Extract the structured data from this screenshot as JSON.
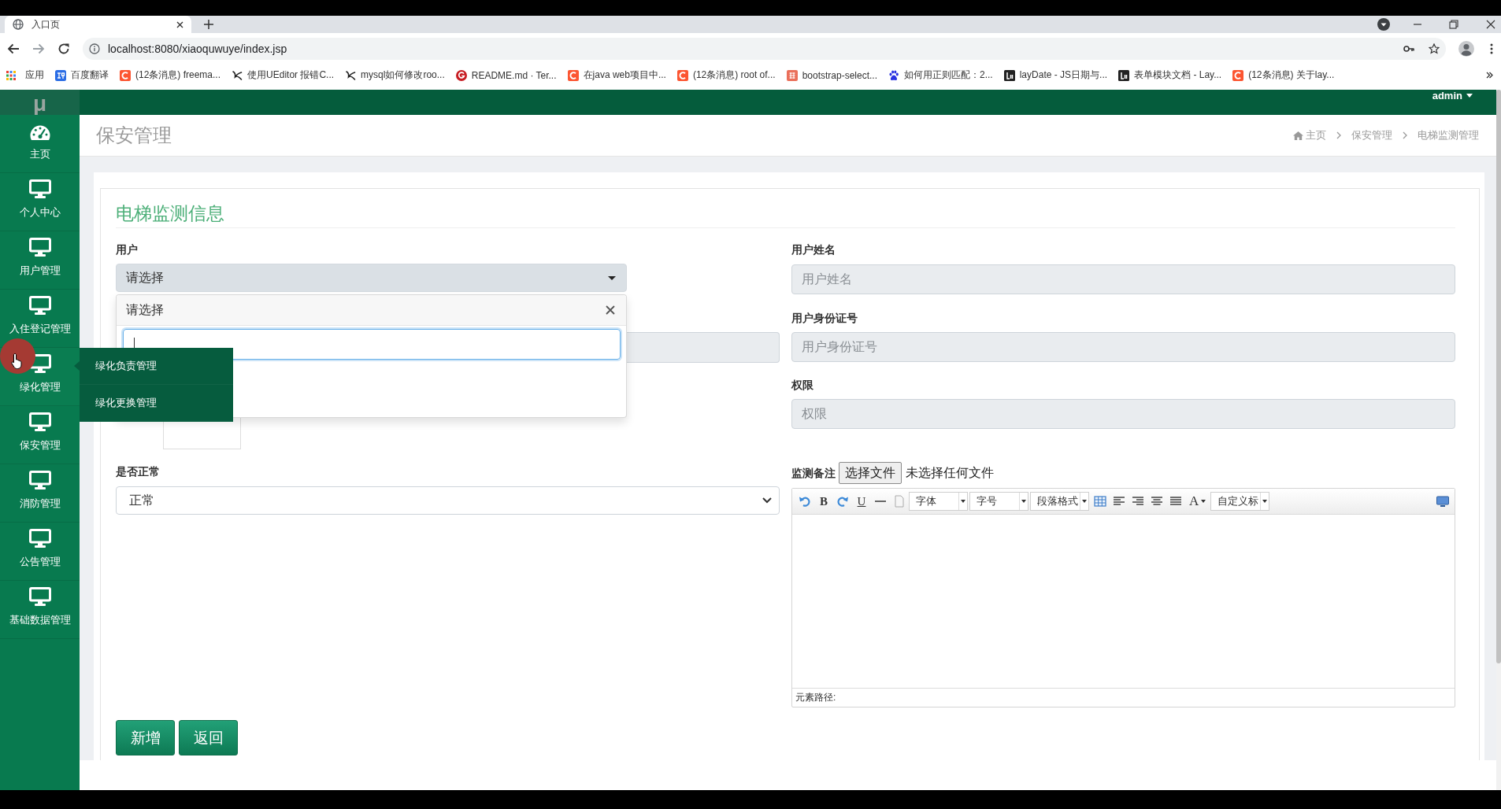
{
  "browser": {
    "tab_title": "入口页",
    "url": "localhost:8080/xiaoquwuye/index.jsp",
    "bookmarks": [
      {
        "label": "应用",
        "kind": "apps"
      },
      {
        "label": "百度翻译",
        "kind": "translate"
      },
      {
        "label": "(12条消息) freema...",
        "kind": "csdn"
      },
      {
        "label": "使用UEditor 报错C...",
        "kind": "swoosh"
      },
      {
        "label": "mysql如何修改roo...",
        "kind": "swoosh"
      },
      {
        "label": "README.md · Ter...",
        "kind": "gitee"
      },
      {
        "label": "在java web项目中...",
        "kind": "csdn"
      },
      {
        "label": "(12条消息) root of...",
        "kind": "csdn"
      },
      {
        "label": "bootstrap-select...",
        "kind": "jianshu"
      },
      {
        "label": "如何用正则匹配：2...",
        "kind": "paw"
      },
      {
        "label": "layDate - JS日期与...",
        "kind": "layui"
      },
      {
        "label": "表单模块文档 - Lay...",
        "kind": "layui"
      },
      {
        "label": "(12条消息) 关于lay...",
        "kind": "csdn"
      }
    ]
  },
  "app": {
    "logo": "μ",
    "user": "admin"
  },
  "sidebar": {
    "items": [
      {
        "label": "主页",
        "kind": "home",
        "expanded": false
      },
      {
        "label": "个人中心",
        "kind": "module",
        "expanded": false
      },
      {
        "label": "用户管理",
        "kind": "module",
        "expanded": false
      },
      {
        "label": "入住登记管理",
        "kind": "module",
        "expanded": false
      },
      {
        "label": "绿化管理",
        "kind": "module",
        "expanded": true,
        "submenu": [
          "绿化负责管理",
          "绿化更换管理"
        ]
      },
      {
        "label": "保安管理",
        "kind": "module",
        "expanded": false
      },
      {
        "label": "消防管理",
        "kind": "module",
        "expanded": false
      },
      {
        "label": "公告管理",
        "kind": "module",
        "expanded": false
      },
      {
        "label": "基础数据管理",
        "kind": "module",
        "expanded": false
      }
    ]
  },
  "page": {
    "title": "保安管理",
    "breadcrumb": [
      "主页",
      "保安管理",
      "电梯监测管理"
    ]
  },
  "form": {
    "title": "电梯监测信息",
    "user": {
      "label": "用户",
      "value": "请选择",
      "expanded": true,
      "menu": {
        "header": "请选择",
        "search_focused": true
      }
    },
    "status": {
      "label": "是否正常",
      "value": "正常"
    },
    "fields": [
      {
        "label": "用户姓名",
        "placeholder": "用户姓名",
        "disabled": true
      },
      {
        "label": "用户身份证号",
        "placeholder": "用户身份证号",
        "disabled": true
      },
      {
        "label": "权限",
        "placeholder": "权限",
        "disabled": true
      }
    ],
    "remark": {
      "label": "监测备注",
      "file_button": "选择文件",
      "file_status": "未选择任何文件",
      "toolbar": {
        "bold": "B",
        "underline": "U",
        "font": "字体",
        "size": "字号",
        "paragraph": "段落格式",
        "font_color_button": "A",
        "heading": "自定义标"
      },
      "path_label": "元素路径:"
    }
  },
  "buttons": [
    {
      "label": "新增"
    },
    {
      "label": "返回"
    }
  ]
}
